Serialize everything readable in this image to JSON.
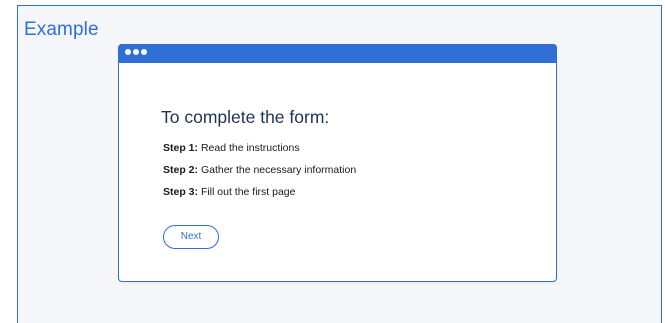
{
  "header": {
    "title": "Example"
  },
  "window": {
    "controls": [
      "dot-icon",
      "dot-icon",
      "dot-icon"
    ]
  },
  "form": {
    "heading": "To complete the form:",
    "steps": [
      {
        "label": "Step 1:",
        "text": "Read the instructions"
      },
      {
        "label": "Step 2:",
        "text": "Gather the necessary information"
      },
      {
        "label": "Step 3:",
        "text": "Fill out the first page"
      }
    ],
    "next_label": "Next"
  },
  "colors": {
    "accent": "#2f6fd6",
    "heading": "#1e3352",
    "background": "#f4f6f9"
  }
}
